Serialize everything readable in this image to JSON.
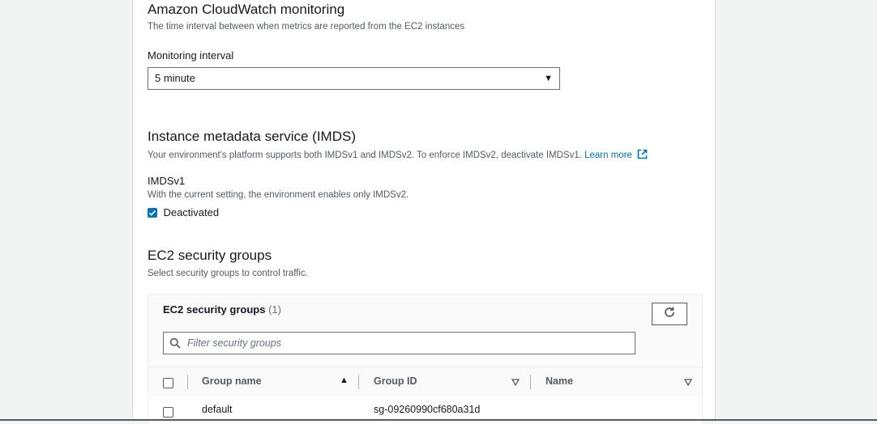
{
  "cloudwatch": {
    "title": "Amazon CloudWatch monitoring",
    "description": "The time interval between when metrics are reported from the EC2 instances",
    "interval_label": "Monitoring interval",
    "interval_value": "5 minute"
  },
  "imds": {
    "title": "Instance metadata service (IMDS)",
    "description": "Your environment's platform supports both IMDSv1 and IMDSv2. To enforce IMDSv2, deactivate IMDSv1.",
    "learn_more": "Learn more",
    "v1_label": "IMDSv1",
    "v1_description": "With the current setting, the environment enables only IMDSv2.",
    "v1_checkbox_label": "Deactivated",
    "v1_checked": true
  },
  "security_groups": {
    "title": "EC2 security groups",
    "description": "Select security groups to control traffic.",
    "table_title": "EC2 security groups",
    "count": "(1)",
    "filter_placeholder": "Filter security groups",
    "columns": [
      "Group name",
      "Group ID",
      "Name"
    ],
    "rows": [
      {
        "group_name": "default",
        "group_id": "sg-09260990cf680a31d",
        "name": "",
        "selected": false
      }
    ]
  },
  "icons": {
    "refresh": "refresh-icon",
    "search": "search-icon",
    "external": "external-link-icon",
    "caret": "caret-down-icon",
    "sort_asc": "sort-ascending-icon",
    "sort_desc": "sort-descending-icon"
  },
  "colors": {
    "link": "#0073bb",
    "checkbox": "#0073bb",
    "text": "#16191f",
    "muted": "#545b64"
  }
}
